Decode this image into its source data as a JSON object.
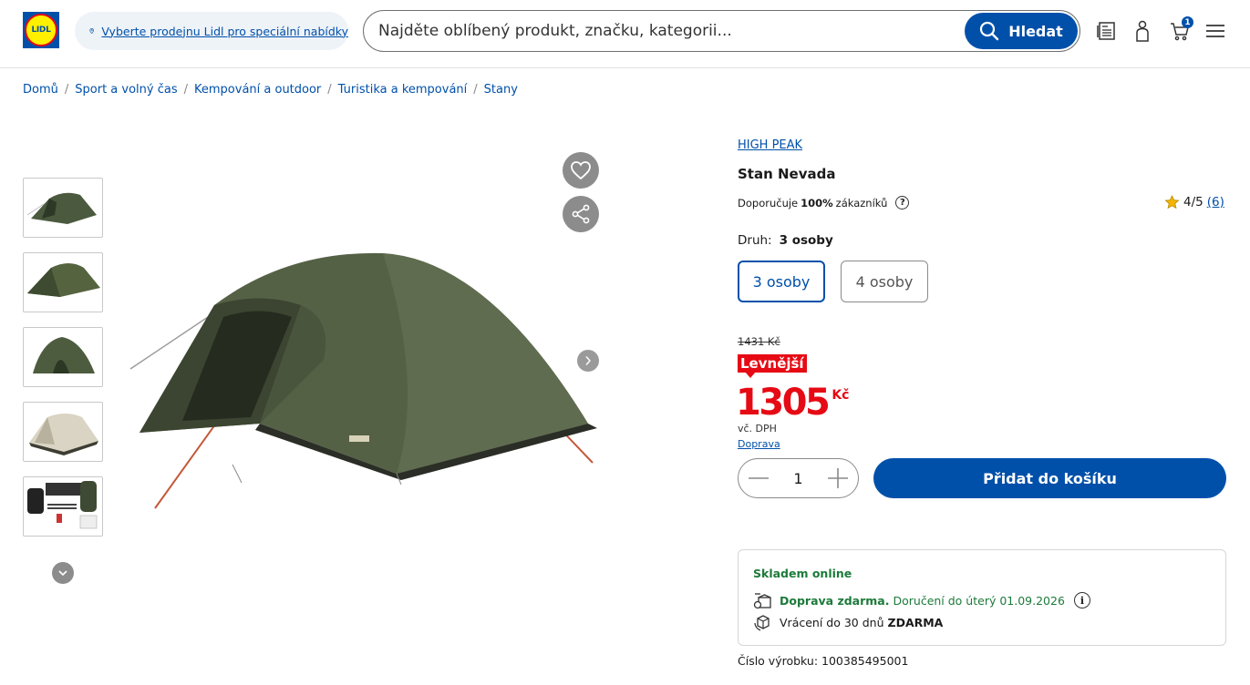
{
  "header": {
    "logo_text": "LIDL",
    "store_link": "Vyberte prodejnu Lidl pro speciální nabídky",
    "search_placeholder": "Najděte oblíbený produkt, značku, kategorii...",
    "search_button": "Hledat",
    "cart_count": "1",
    "icons": [
      "leaflet-icon",
      "user-icon",
      "cart-icon",
      "menu-icon"
    ]
  },
  "breadcrumb": [
    "Domů",
    "Sport a volný čas",
    "Kempování a outdoor",
    "Turistika a kempování",
    "Stany"
  ],
  "product": {
    "brand": "HIGH PEAK",
    "title": "Stan Nevada",
    "recommend_prefix": "Doporučuje",
    "recommend_pct": "100%",
    "recommend_suffix": "zákazníků",
    "rating": "4/5",
    "rating_count": "(6)",
    "variant_label": "Druh:",
    "variant_selected": "3 osoby",
    "variants": [
      "3 osoby",
      "4 osoby"
    ],
    "old_price": "1431 Kč",
    "badge": "Levnější",
    "price": "1305",
    "currency": "Kč",
    "vat": "vč. DPH",
    "shipping_link": "Doprava",
    "quantity": "1",
    "add_to_cart": "Přidat do košíku"
  },
  "availability": {
    "stock": "Skladem online",
    "free_shipping": "Doprava zdarma.",
    "delivery": "Doručení do úterý 01.09.2026",
    "returns_prefix": "Vrácení do 30 dnů",
    "returns_free": "ZDARMA"
  },
  "product_number": "Číslo výrobku: 100385495001",
  "colors": {
    "brand_blue": "#0050aa",
    "price_red": "#e60a14",
    "stock_green": "#1c7a3a"
  }
}
